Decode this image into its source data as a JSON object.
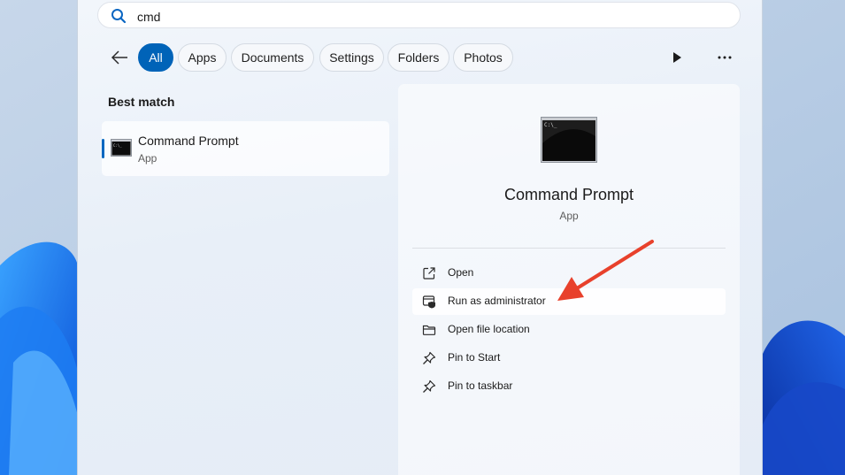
{
  "search": {
    "query": "cmd"
  },
  "filters": [
    {
      "label": "All",
      "active": true
    },
    {
      "label": "Apps",
      "active": false
    },
    {
      "label": "Documents",
      "active": false
    },
    {
      "label": "Settings",
      "active": false
    },
    {
      "label": "Folders",
      "active": false
    },
    {
      "label": "Photos",
      "active": false
    }
  ],
  "best_match": {
    "heading": "Best match",
    "item": {
      "title": "Command Prompt",
      "type": "App",
      "icon": "cmd-icon"
    }
  },
  "details": {
    "title": "Command Prompt",
    "type": "App",
    "actions": [
      {
        "label": "Open",
        "icon": "open-icon"
      },
      {
        "label": "Run as administrator",
        "icon": "shield-admin-icon"
      },
      {
        "label": "Open file location",
        "icon": "folder-icon"
      },
      {
        "label": "Pin to Start",
        "icon": "pin-icon"
      },
      {
        "label": "Pin to taskbar",
        "icon": "pin-icon"
      }
    ]
  },
  "colors": {
    "accent": "#0063b8",
    "annotation_arrow": "#e8412c"
  }
}
